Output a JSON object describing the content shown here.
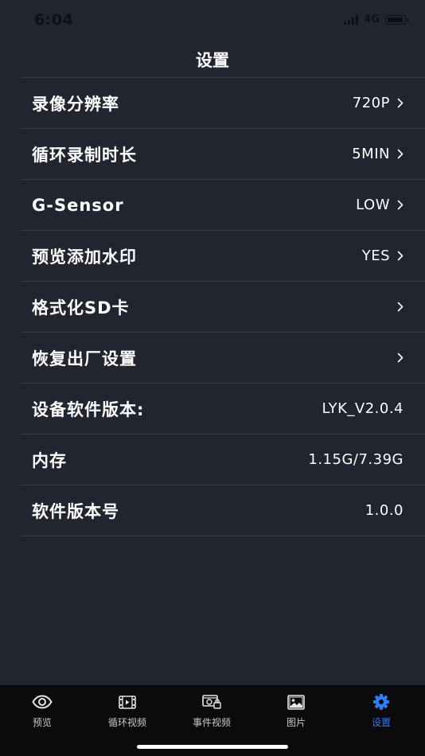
{
  "status_bar": {
    "time": "6:04",
    "network": "4G"
  },
  "header": {
    "title": "设置"
  },
  "settings": [
    {
      "label": "录像分辨率",
      "value": "720P",
      "chevron": true
    },
    {
      "label": "循环录制时长",
      "value": "5MIN",
      "chevron": true
    },
    {
      "label": "G-Sensor",
      "value": "LOW",
      "chevron": true
    },
    {
      "label": "预览添加水印",
      "value": "YES",
      "chevron": true
    },
    {
      "label": "格式化SD卡",
      "value": "",
      "chevron": true
    },
    {
      "label": "恢复出厂设置",
      "value": "",
      "chevron": true
    },
    {
      "label": "设备软件版本:",
      "value": "LYK_V2.0.4",
      "chevron": false
    },
    {
      "label": "内存",
      "value": "1.15G/7.39G",
      "chevron": false
    },
    {
      "label": "软件版本号",
      "value": "1.0.0",
      "chevron": false
    }
  ],
  "tabbar": {
    "tabs": [
      {
        "label": "预览",
        "icon": "eye-icon"
      },
      {
        "label": "循环视频",
        "icon": "film-icon"
      },
      {
        "label": "事件视频",
        "icon": "locked-video-icon"
      },
      {
        "label": "图片",
        "icon": "image-icon"
      },
      {
        "label": "设置",
        "icon": "gear-icon"
      }
    ],
    "active_index": 4
  },
  "colors": {
    "background": "#22252f",
    "tabbar_background": "#0b0b0e",
    "accent": "#2f7cf6",
    "divider": "#3a3e4b"
  }
}
